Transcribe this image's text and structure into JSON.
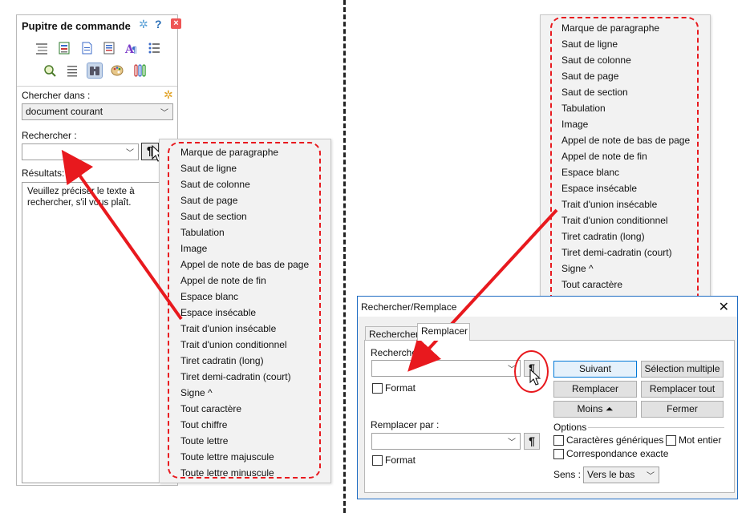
{
  "left_panel": {
    "title": "Pupitre de commande",
    "search_in_label": "Chercher dans :",
    "search_in_value": "document courant",
    "search_label": "Rechercher :",
    "search_value": "",
    "special_button": "¶",
    "results_label": "Résultats:",
    "results_text": "Veuillez préciser le texte à rechercher, s'il vous plaît."
  },
  "menu_items": [
    "Marque de paragraphe",
    "Saut de ligne",
    "Saut de colonne",
    "Saut de page",
    "Saut de section",
    "Tabulation",
    "Image",
    "Appel de note de bas de page",
    "Appel de note de fin",
    "Espace blanc",
    "Espace insécable",
    "Trait d'union insécable",
    "Trait d'union conditionnel",
    "Tiret cadratin (long)",
    "Tiret demi-cadratin (court)",
    "Signe ^",
    "Tout caractère",
    "Tout chiffre",
    "Toute lettre",
    "Toute lettre majuscule",
    "Toute lettre minuscule"
  ],
  "dialog": {
    "title": "Rechercher/Remplace",
    "tabs": [
      "Rechercher",
      "Remplacer"
    ],
    "find_label": "Rechercher",
    "format_label": "Format",
    "replace_label": "Remplacer par :",
    "special_button": "¶",
    "buttons": {
      "next": "Suivant",
      "multi": "Sélection multiple",
      "replace": "Remplacer",
      "replace_all": "Remplacer tout",
      "less": "Moins ⏶",
      "close": "Fermer"
    },
    "options_label": "Options",
    "opt_wildcards": "Caractères génériques",
    "opt_whole_word": "Mot entier",
    "opt_match_case": "Correspondance exacte",
    "direction_label": "Sens :",
    "direction_value": "Vers le bas"
  },
  "colors": {
    "annotation_red": "#e8191e",
    "dialog_border": "#1e6cc3"
  }
}
